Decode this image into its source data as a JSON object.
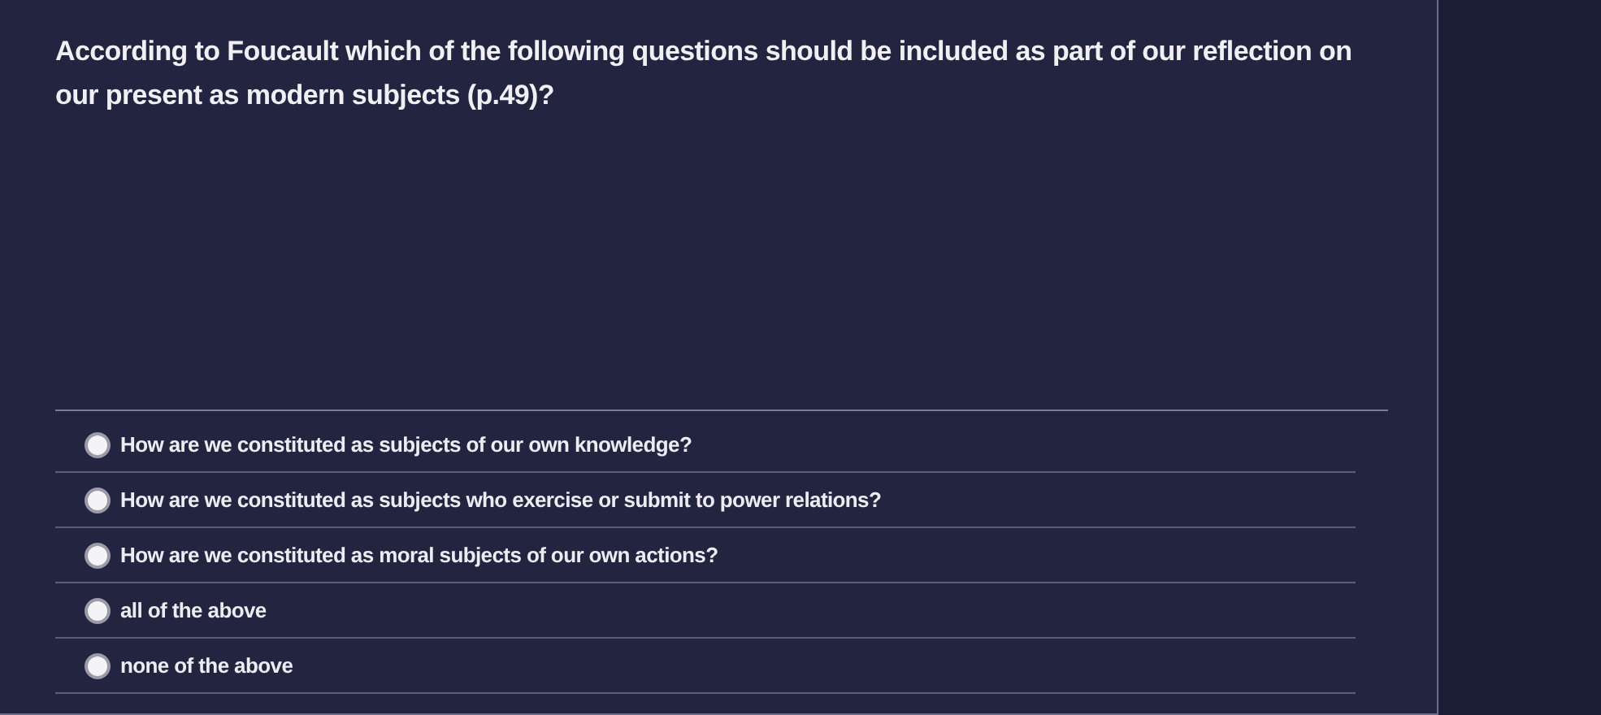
{
  "question": "According to Foucault which of the following questions should be included as part of our reflection on our present as modern subjects (p.49)?",
  "options": [
    {
      "label": "How are we constituted as subjects of our own knowledge?",
      "selected": false
    },
    {
      "label": "How are we constituted as subjects who exercise or submit to power relations?",
      "selected": false
    },
    {
      "label": "How are we constituted as moral subjects of our own actions?",
      "selected": false
    },
    {
      "label": "all of the above",
      "selected": false
    },
    {
      "label": "none of the above",
      "selected": false
    }
  ]
}
